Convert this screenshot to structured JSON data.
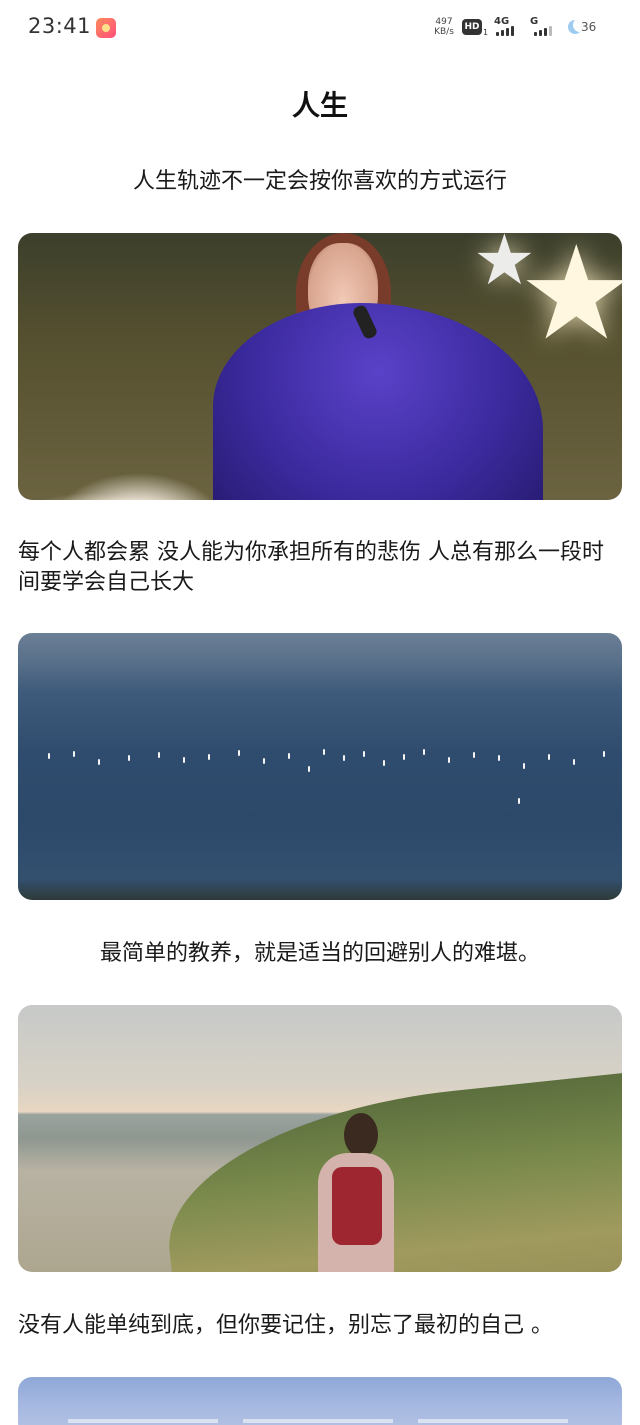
{
  "status_bar": {
    "time": "23:41",
    "speed_value": "497",
    "speed_unit": "KB/s",
    "hd_label": "HD",
    "hd_sub": "1",
    "net_1": "4G",
    "net_2": "G",
    "battery": "36"
  },
  "page": {
    "title": "人生",
    "subtitle": "人生轨迹不一定会按你喜欢的方式运行",
    "paragraph_1": "每个人都会累 没人能为你承担所有的悲伤 人总有那么一段时间要学会自己长大",
    "paragraph_2": "最简单的教养，就是适当的回避别人的难堪。",
    "paragraph_3": "没有人能单纯到底，但你要记住，别忘了最初的自己 。"
  },
  "icons": {
    "app_notification": "app-notification-icon",
    "battery": "battery-icon"
  }
}
